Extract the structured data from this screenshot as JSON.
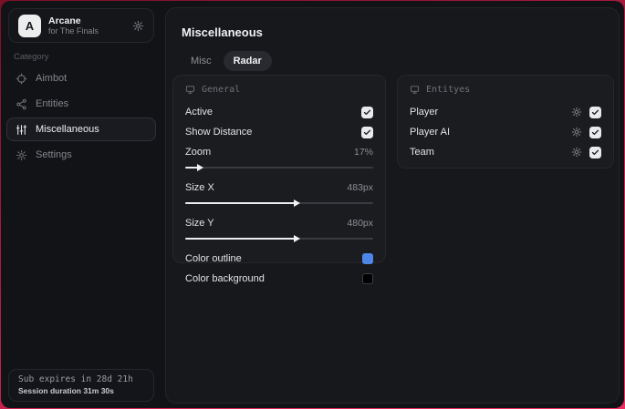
{
  "backdrop_color": "#c01e4a",
  "sidebar": {
    "brand": {
      "logo_letter": "A",
      "title": "Arcane",
      "subtitle": "for The Finals"
    },
    "category_label": "Category",
    "items": [
      {
        "label": "Aimbot",
        "icon": "crosshair-icon",
        "active": false
      },
      {
        "label": "Entities",
        "icon": "entities-icon",
        "active": false
      },
      {
        "label": "Miscellaneous",
        "icon": "sliders-icon",
        "active": true
      },
      {
        "label": "Settings",
        "icon": "gear-icon",
        "active": false
      }
    ],
    "subscription": {
      "line1": "Sub expires in 28d 21h",
      "line2": "Session duration 31m 30s"
    }
  },
  "main": {
    "title": "Miscellaneous",
    "tabs": [
      {
        "label": "Misc",
        "active": false
      },
      {
        "label": "Radar",
        "active": true
      }
    ],
    "general_card": {
      "header": "General",
      "toggles": [
        {
          "label": "Active",
          "checked": true
        },
        {
          "label": "Show Distance",
          "checked": true
        }
      ],
      "sliders": [
        {
          "label": "Zoom",
          "value": "17%",
          "percent": 8
        },
        {
          "label": "Size X",
          "value": "483px",
          "percent": 59
        },
        {
          "label": "Size Y",
          "value": "480px",
          "percent": 59
        }
      ],
      "colors": [
        {
          "label": "Color outline",
          "swatch": "#4e86e8"
        },
        {
          "label": "Color background",
          "swatch": "#000000"
        }
      ]
    },
    "entities_card": {
      "header": "Entityes",
      "rows": [
        {
          "label": "Player",
          "checked": true
        },
        {
          "label": "Player AI",
          "checked": true
        },
        {
          "label": "Team",
          "checked": true
        }
      ]
    }
  }
}
